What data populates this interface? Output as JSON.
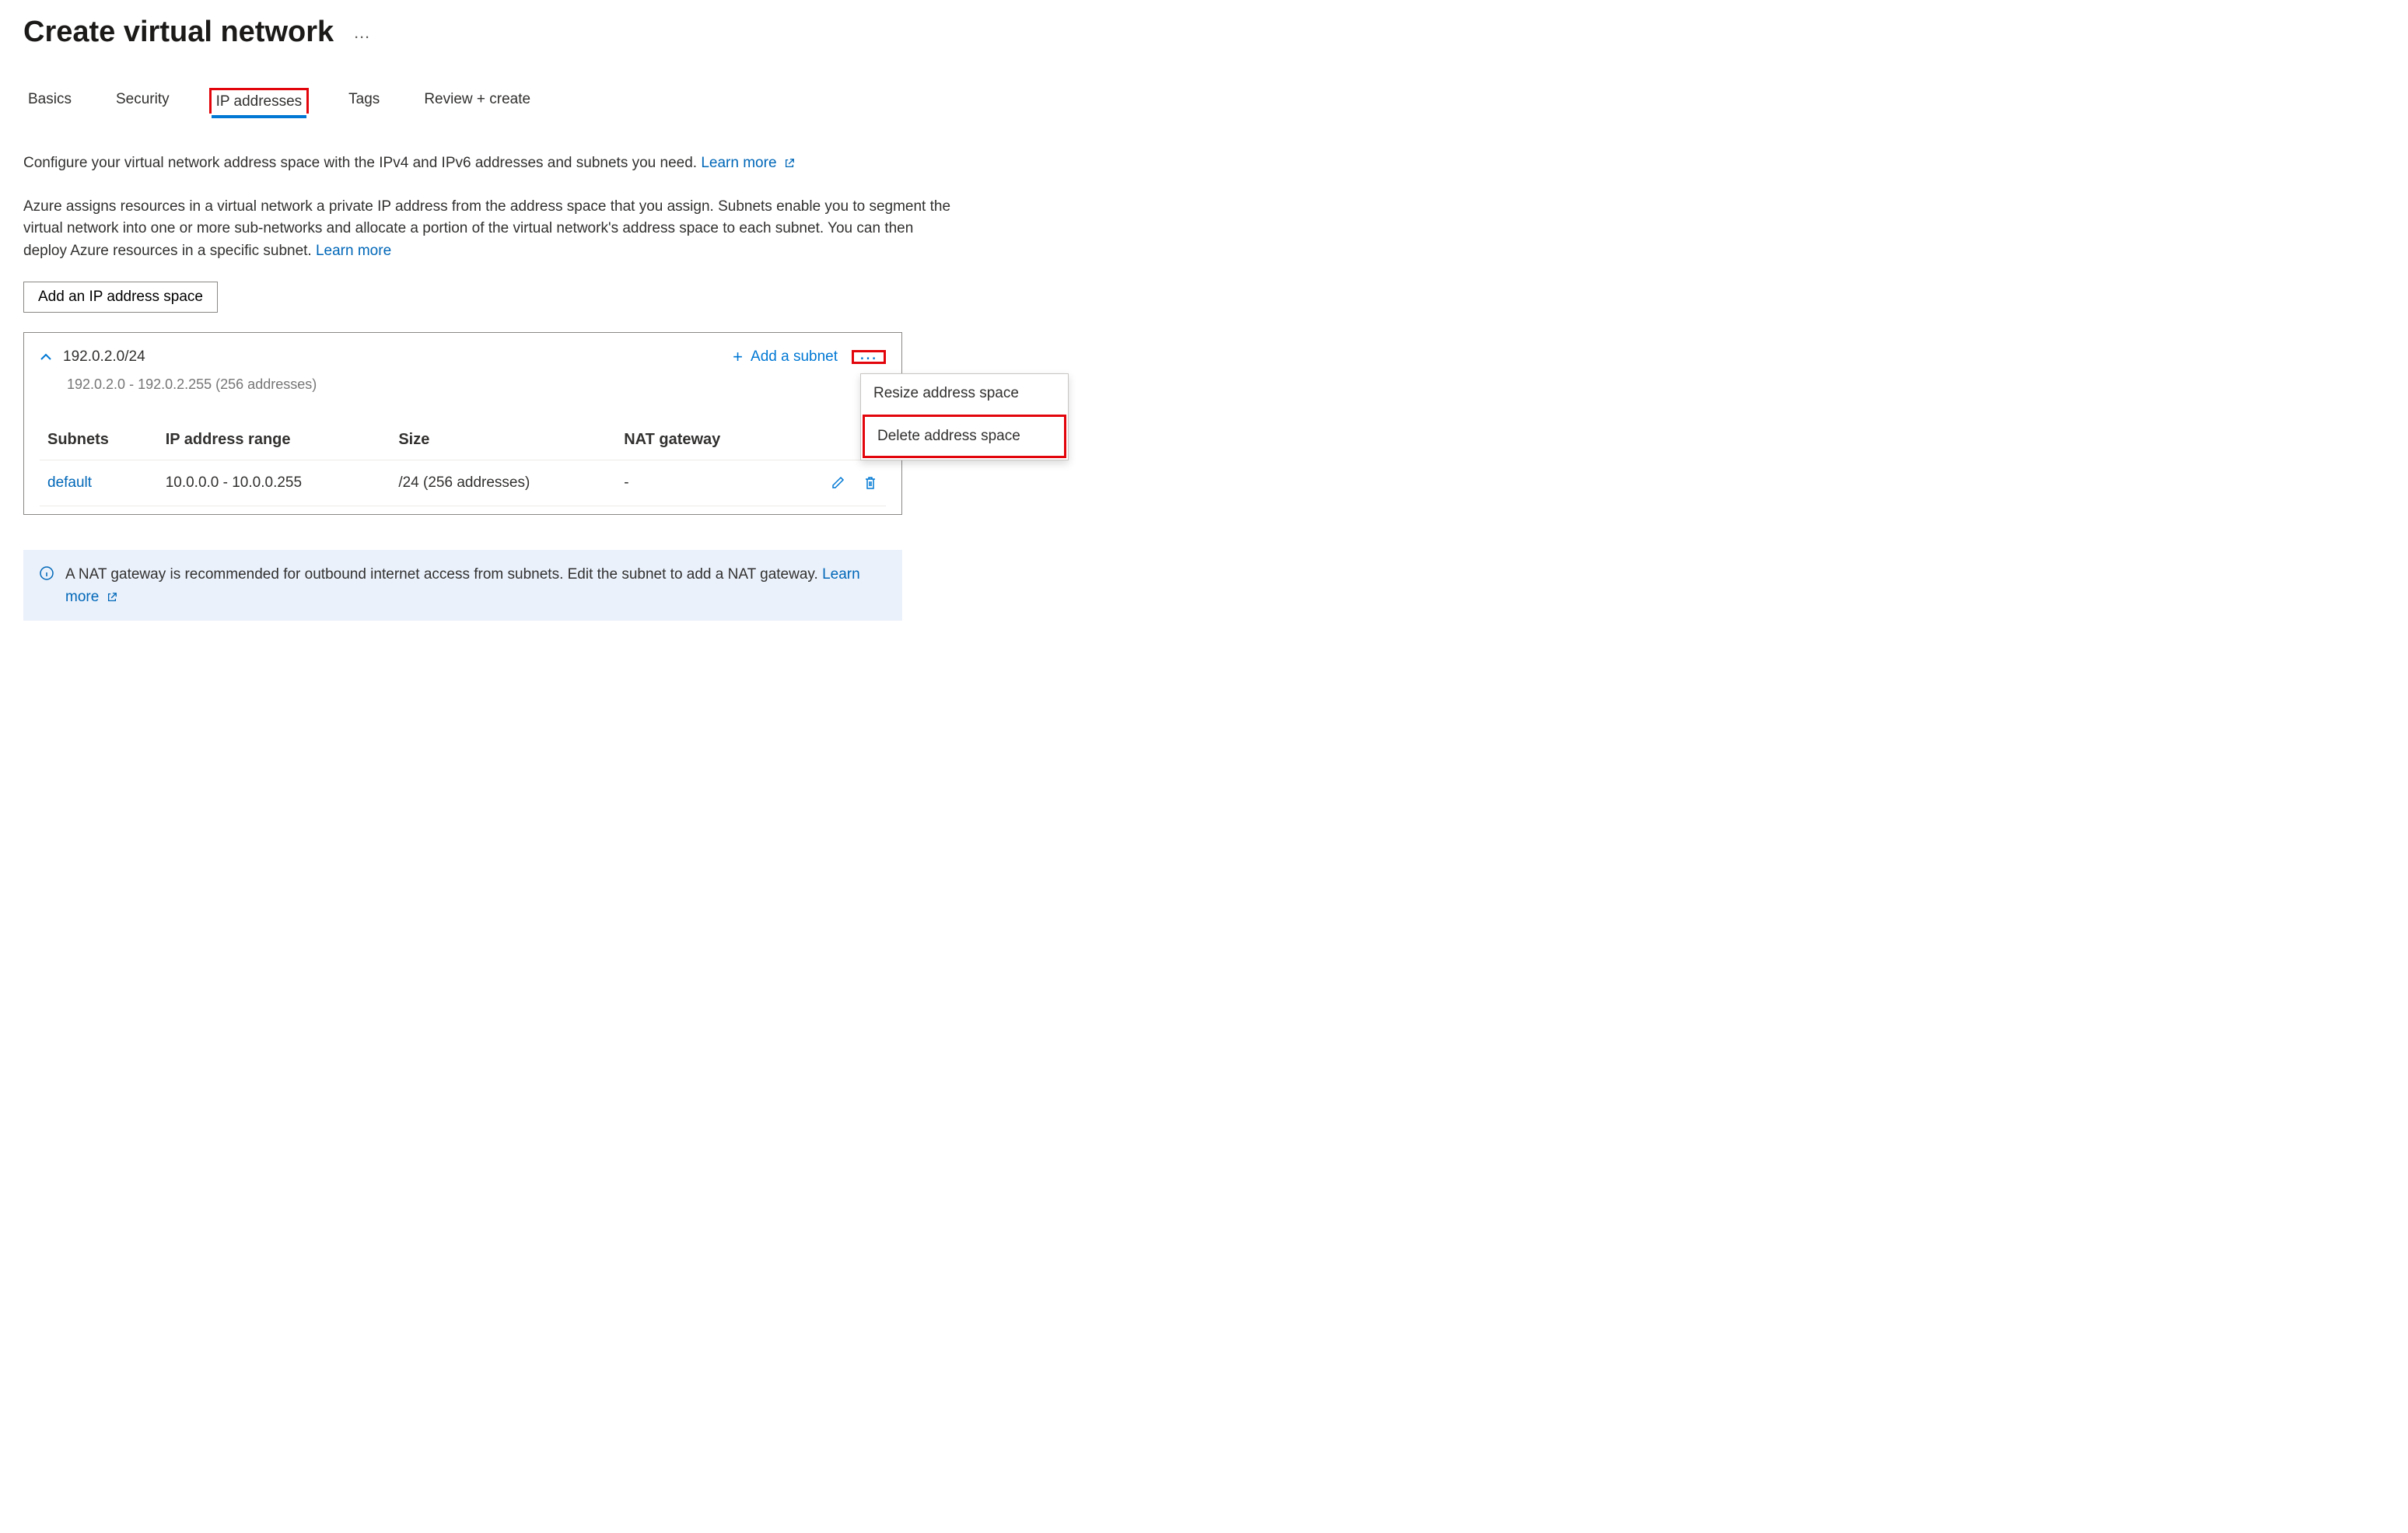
{
  "page": {
    "title": "Create virtual network"
  },
  "tabs": {
    "basics": "Basics",
    "security": "Security",
    "ip_addresses": "IP addresses",
    "tags": "Tags",
    "review": "Review + create"
  },
  "intro": {
    "line1": "Configure your virtual network address space with the IPv4 and IPv6 addresses and subnets you need. ",
    "learn_more": "Learn more",
    "line2": "Azure assigns resources in a virtual network a private IP address from the address space that you assign. Subnets enable you to segment the virtual network into one or more sub-networks and allocate a portion of the virtual network's address space to each subnet. You can then deploy Azure resources in a specific subnet. "
  },
  "buttons": {
    "add_address_space": "Add an IP address space",
    "add_subnet": "Add a subnet"
  },
  "address_space": {
    "cidr": "192.0.2.0/24",
    "range_hint": "192.0.2.0 - 192.0.2.255 (256 addresses)"
  },
  "context_menu": {
    "resize": "Resize address space",
    "delete": "Delete address space"
  },
  "columns": {
    "subnets": "Subnets",
    "ip_range": "IP address range",
    "size": "Size",
    "nat": "NAT gateway"
  },
  "subnet_row": {
    "name": "default",
    "range": "10.0.0.0 - 10.0.0.255",
    "size": "/24 (256 addresses)",
    "nat": "-"
  },
  "banner": {
    "text": "A NAT gateway is recommended for outbound internet access from subnets. Edit the subnet to add a NAT gateway.  ",
    "learn_more": "Learn more"
  }
}
